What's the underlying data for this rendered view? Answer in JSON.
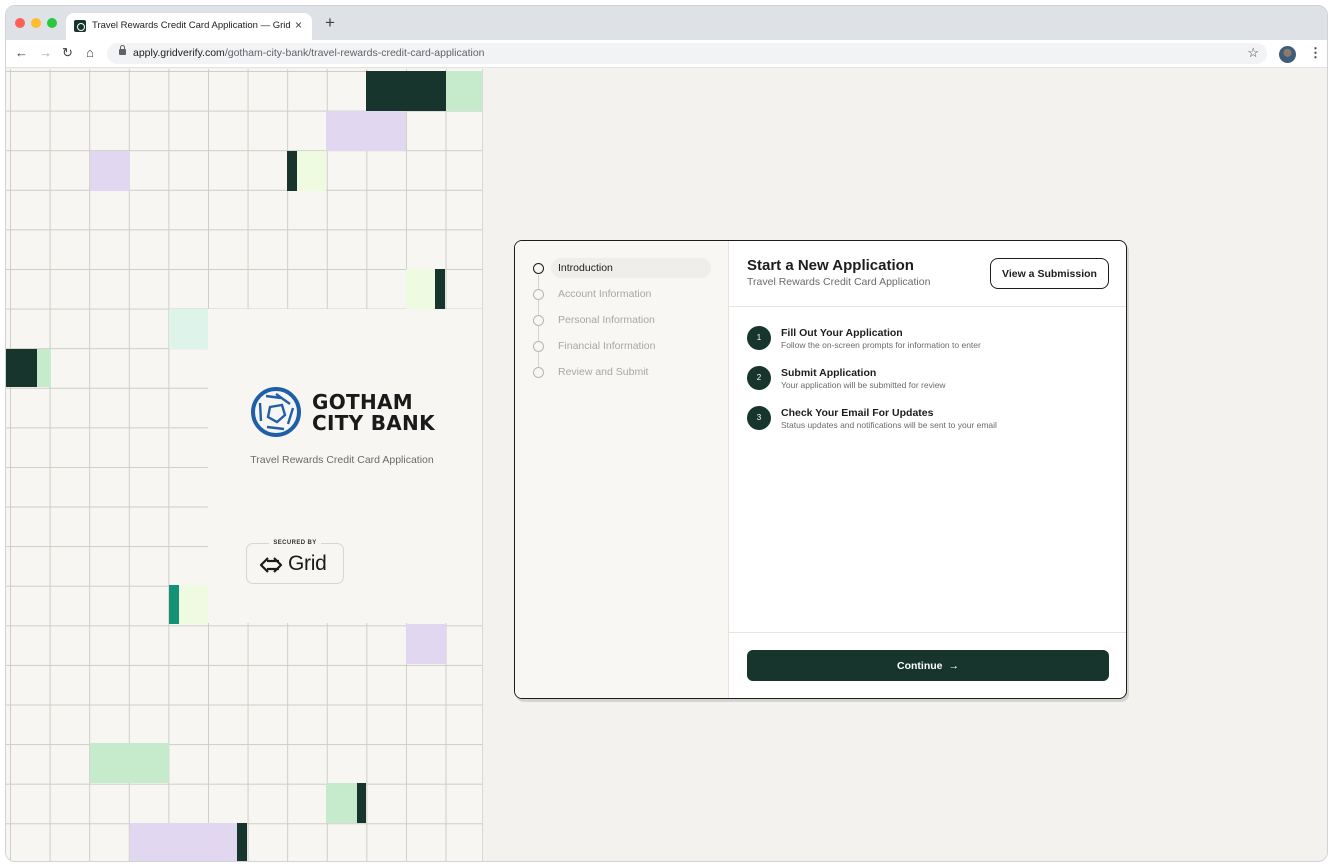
{
  "browser": {
    "tab_title": "Travel Rewards Credit Card Application — Grid",
    "tab_close": "×",
    "new_tab": "+",
    "url_host": "apply.gridverify.com",
    "url_path": "/gotham-city-bank/travel-rewards-credit-card-application",
    "icons": [
      "back-icon",
      "forward-icon",
      "reload-icon",
      "home-icon",
      "lock-icon",
      "star-icon",
      "profile-avatar",
      "more-menu-icon"
    ]
  },
  "brand": {
    "bank_name_line1": "GOTHAM",
    "bank_name_line2": "CITY BANK",
    "subtitle": "Travel Rewards Credit Card Application",
    "secured_label": "SECURED BY",
    "secured_brand": "Grid"
  },
  "steps": [
    {
      "label": "Introduction",
      "active": true
    },
    {
      "label": "Account Information",
      "active": false
    },
    {
      "label": "Personal Information",
      "active": false
    },
    {
      "label": "Financial Information",
      "active": false
    },
    {
      "label": "Review and Submit",
      "active": false
    }
  ],
  "main": {
    "title": "Start a New Application",
    "subtitle": "Travel Rewards Credit Card Application",
    "view_button": "View a Submission",
    "instructions": [
      {
        "num": "1",
        "title": "Fill Out Your Application",
        "desc": "Follow the on-screen prompts for information to enter"
      },
      {
        "num": "2",
        "title": "Submit Application",
        "desc": "Your application will be submitted for review"
      },
      {
        "num": "3",
        "title": "Check Your Email For Updates",
        "desc": "Status updates and notifications will be sent to your email"
      }
    ],
    "continue_button": "Continue",
    "continue_arrow": "→"
  },
  "colors": {
    "brand_dark_green": "#17352c",
    "brand_blue": "#1f5fa8",
    "grid_light_green": "#c6ebcc",
    "grid_lavender": "#e2d7f1",
    "grid_lime": "#effbe1",
    "grid_teal": "#159175"
  }
}
